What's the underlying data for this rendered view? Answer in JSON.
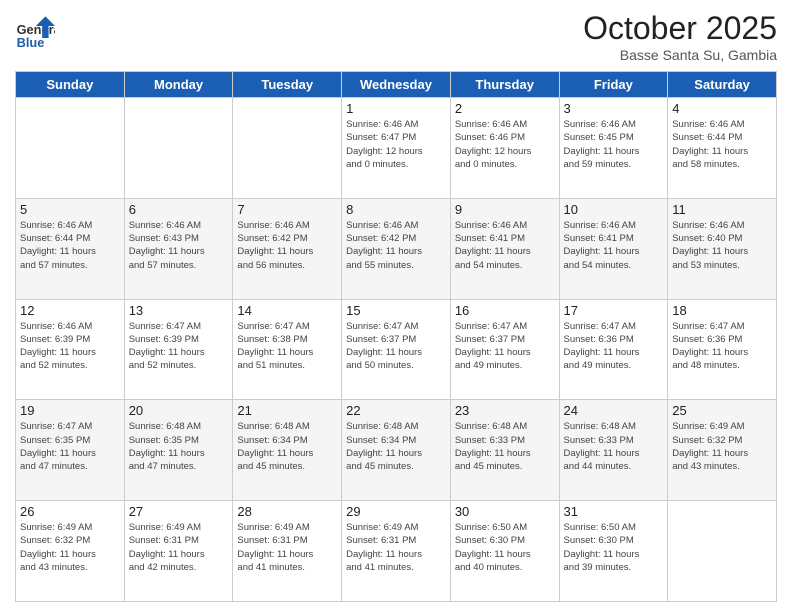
{
  "header": {
    "logo_general": "General",
    "logo_blue": "Blue",
    "month_title": "October 2025",
    "location": "Basse Santa Su, Gambia"
  },
  "days_of_week": [
    "Sunday",
    "Monday",
    "Tuesday",
    "Wednesday",
    "Thursday",
    "Friday",
    "Saturday"
  ],
  "weeks": [
    [
      {
        "day": "",
        "info": ""
      },
      {
        "day": "",
        "info": ""
      },
      {
        "day": "",
        "info": ""
      },
      {
        "day": "1",
        "info": "Sunrise: 6:46 AM\nSunset: 6:47 PM\nDaylight: 12 hours\nand 0 minutes."
      },
      {
        "day": "2",
        "info": "Sunrise: 6:46 AM\nSunset: 6:46 PM\nDaylight: 12 hours\nand 0 minutes."
      },
      {
        "day": "3",
        "info": "Sunrise: 6:46 AM\nSunset: 6:45 PM\nDaylight: 11 hours\nand 59 minutes."
      },
      {
        "day": "4",
        "info": "Sunrise: 6:46 AM\nSunset: 6:44 PM\nDaylight: 11 hours\nand 58 minutes."
      }
    ],
    [
      {
        "day": "5",
        "info": "Sunrise: 6:46 AM\nSunset: 6:44 PM\nDaylight: 11 hours\nand 57 minutes."
      },
      {
        "day": "6",
        "info": "Sunrise: 6:46 AM\nSunset: 6:43 PM\nDaylight: 11 hours\nand 57 minutes."
      },
      {
        "day": "7",
        "info": "Sunrise: 6:46 AM\nSunset: 6:42 PM\nDaylight: 11 hours\nand 56 minutes."
      },
      {
        "day": "8",
        "info": "Sunrise: 6:46 AM\nSunset: 6:42 PM\nDaylight: 11 hours\nand 55 minutes."
      },
      {
        "day": "9",
        "info": "Sunrise: 6:46 AM\nSunset: 6:41 PM\nDaylight: 11 hours\nand 54 minutes."
      },
      {
        "day": "10",
        "info": "Sunrise: 6:46 AM\nSunset: 6:41 PM\nDaylight: 11 hours\nand 54 minutes."
      },
      {
        "day": "11",
        "info": "Sunrise: 6:46 AM\nSunset: 6:40 PM\nDaylight: 11 hours\nand 53 minutes."
      }
    ],
    [
      {
        "day": "12",
        "info": "Sunrise: 6:46 AM\nSunset: 6:39 PM\nDaylight: 11 hours\nand 52 minutes."
      },
      {
        "day": "13",
        "info": "Sunrise: 6:47 AM\nSunset: 6:39 PM\nDaylight: 11 hours\nand 52 minutes."
      },
      {
        "day": "14",
        "info": "Sunrise: 6:47 AM\nSunset: 6:38 PM\nDaylight: 11 hours\nand 51 minutes."
      },
      {
        "day": "15",
        "info": "Sunrise: 6:47 AM\nSunset: 6:37 PM\nDaylight: 11 hours\nand 50 minutes."
      },
      {
        "day": "16",
        "info": "Sunrise: 6:47 AM\nSunset: 6:37 PM\nDaylight: 11 hours\nand 49 minutes."
      },
      {
        "day": "17",
        "info": "Sunrise: 6:47 AM\nSunset: 6:36 PM\nDaylight: 11 hours\nand 49 minutes."
      },
      {
        "day": "18",
        "info": "Sunrise: 6:47 AM\nSunset: 6:36 PM\nDaylight: 11 hours\nand 48 minutes."
      }
    ],
    [
      {
        "day": "19",
        "info": "Sunrise: 6:47 AM\nSunset: 6:35 PM\nDaylight: 11 hours\nand 47 minutes."
      },
      {
        "day": "20",
        "info": "Sunrise: 6:48 AM\nSunset: 6:35 PM\nDaylight: 11 hours\nand 47 minutes."
      },
      {
        "day": "21",
        "info": "Sunrise: 6:48 AM\nSunset: 6:34 PM\nDaylight: 11 hours\nand 45 minutes."
      },
      {
        "day": "22",
        "info": "Sunrise: 6:48 AM\nSunset: 6:34 PM\nDaylight: 11 hours\nand 45 minutes."
      },
      {
        "day": "23",
        "info": "Sunrise: 6:48 AM\nSunset: 6:33 PM\nDaylight: 11 hours\nand 45 minutes."
      },
      {
        "day": "24",
        "info": "Sunrise: 6:48 AM\nSunset: 6:33 PM\nDaylight: 11 hours\nand 44 minutes."
      },
      {
        "day": "25",
        "info": "Sunrise: 6:49 AM\nSunset: 6:32 PM\nDaylight: 11 hours\nand 43 minutes."
      }
    ],
    [
      {
        "day": "26",
        "info": "Sunrise: 6:49 AM\nSunset: 6:32 PM\nDaylight: 11 hours\nand 43 minutes."
      },
      {
        "day": "27",
        "info": "Sunrise: 6:49 AM\nSunset: 6:31 PM\nDaylight: 11 hours\nand 42 minutes."
      },
      {
        "day": "28",
        "info": "Sunrise: 6:49 AM\nSunset: 6:31 PM\nDaylight: 11 hours\nand 41 minutes."
      },
      {
        "day": "29",
        "info": "Sunrise: 6:49 AM\nSunset: 6:31 PM\nDaylight: 11 hours\nand 41 minutes."
      },
      {
        "day": "30",
        "info": "Sunrise: 6:50 AM\nSunset: 6:30 PM\nDaylight: 11 hours\nand 40 minutes."
      },
      {
        "day": "31",
        "info": "Sunrise: 6:50 AM\nSunset: 6:30 PM\nDaylight: 11 hours\nand 39 minutes."
      },
      {
        "day": "",
        "info": ""
      }
    ]
  ]
}
